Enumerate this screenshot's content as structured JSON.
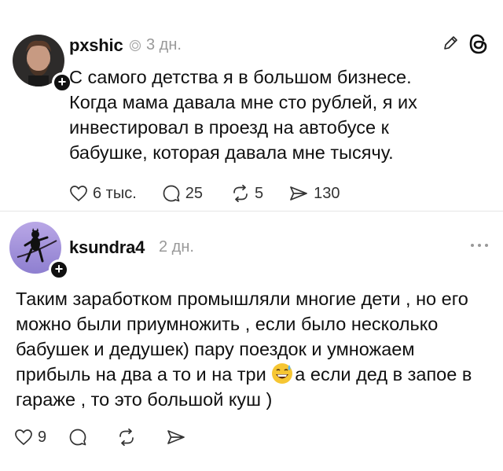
{
  "posts": [
    {
      "username": "pxshic",
      "time": "3 дн.",
      "text": "С самого детства я в большом бизнесе. Когда мама давала мне сто рублей, я их инвестировал в проезд на автобусе к бабушке, которая давала мне тысячу.",
      "actions": {
        "likes": "6 тыс.",
        "replies": "25",
        "reposts": "5",
        "shares": "130"
      }
    },
    {
      "username": "ksundra4",
      "time": "2 дн.",
      "text_part1": "Таким заработком промышляли многие дети , но его можно были приумножить , если было несколько бабушек и дедушек) пару поездок и умножаем прибыль на два а то и на три",
      "text_part2": "а если дед в запое в гараже , то это большой куш )",
      "actions": {
        "likes": "9"
      }
    }
  ],
  "icons": {
    "edit": "pencil-icon",
    "app": "threads-logo-icon",
    "more": "more-dots-icon",
    "emoji": "grinning-sweat-emoji"
  }
}
